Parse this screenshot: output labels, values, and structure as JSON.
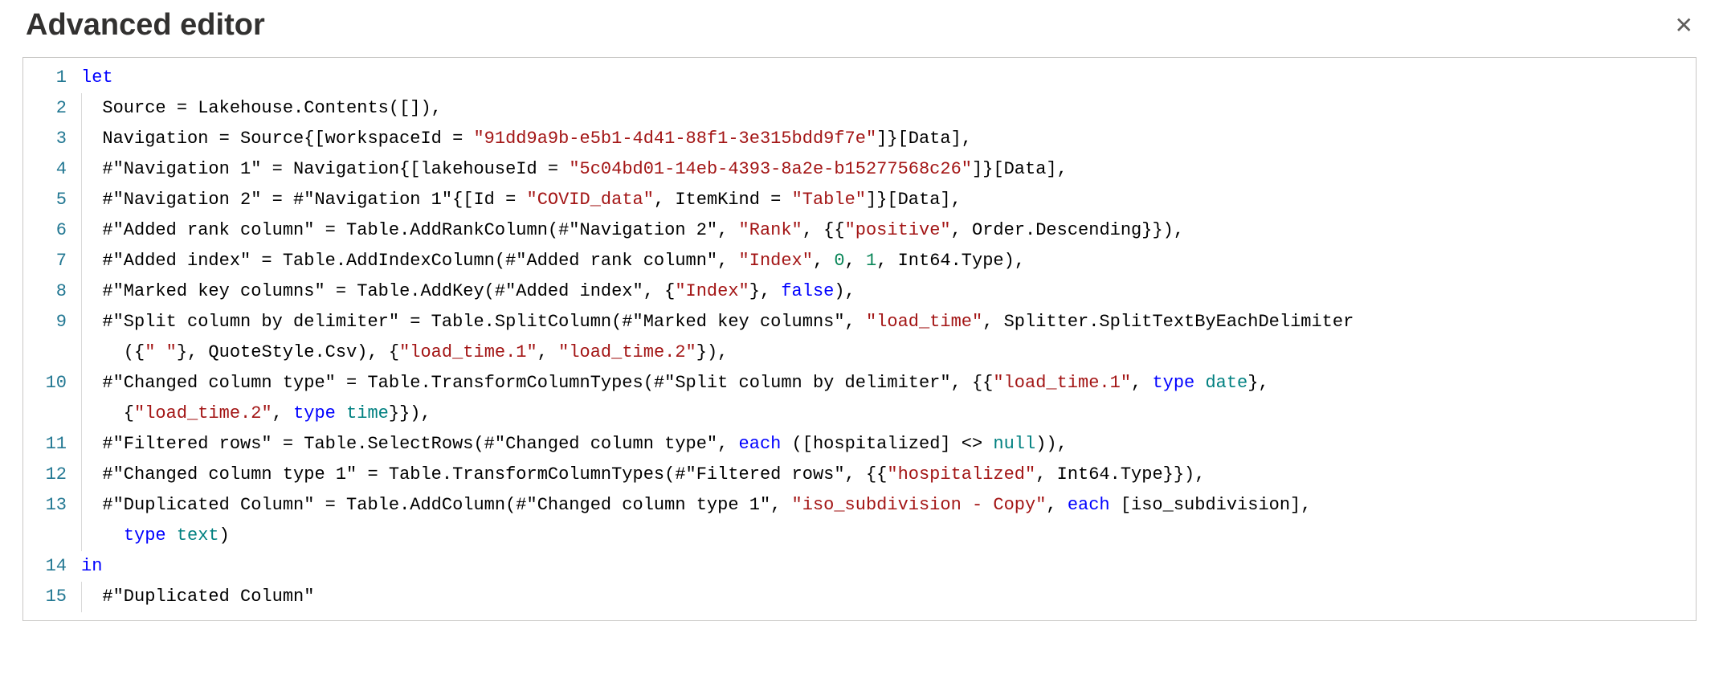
{
  "header": {
    "title": "Advanced editor",
    "close_symbol": "✕"
  },
  "editor": {
    "gutter": [
      "1",
      "2",
      "3",
      "4",
      "5",
      "6",
      "7",
      "8",
      "9",
      "",
      "10",
      "",
      "11",
      "12",
      "13",
      "",
      "14",
      "15"
    ],
    "code": {
      "l1_let": "let",
      "l2_a": "  Source = Lakehouse.Contents([]),",
      "l3_a": "  Navigation = Source{[workspaceId = ",
      "l3_s": "\"91dd9a9b-e5b1-4d41-88f1-3e315bdd9f7e\"",
      "l3_b": "]}[Data],",
      "l4_a": "  #\"Navigation 1\" = Navigation{[lakehouseId = ",
      "l4_s": "\"5c04bd01-14eb-4393-8a2e-b15277568c26\"",
      "l4_b": "]}[Data],",
      "l5_a": "  #\"Navigation 2\" = #\"Navigation 1\"{[Id = ",
      "l5_s1": "\"COVID_data\"",
      "l5_b": ", ItemKind = ",
      "l5_s2": "\"Table\"",
      "l5_c": "]}[Data],",
      "l6_a": "  #\"Added rank column\" = Table.AddRankColumn(#\"Navigation 2\", ",
      "l6_s1": "\"Rank\"",
      "l6_b": ", {{",
      "l6_s2": "\"positive\"",
      "l6_c": ", Order.Descending}}),",
      "l7_a": "  #\"Added index\" = Table.AddIndexColumn(#\"Added rank column\", ",
      "l7_s1": "\"Index\"",
      "l7_b": ", ",
      "l7_n1": "0",
      "l7_c": ", ",
      "l7_n2": "1",
      "l7_d": ", Int64.Type),",
      "l8_a": "  #\"Marked key columns\" = Table.AddKey(#\"Added index\", {",
      "l8_s1": "\"Index\"",
      "l8_b": "}, ",
      "l8_bool": "false",
      "l8_c": "),",
      "l9_a": "  #\"Split column by delimiter\" = Table.SplitColumn(#\"Marked key columns\", ",
      "l9_s1": "\"load_time\"",
      "l9_b": ", Splitter.SplitTextByEachDelimiter",
      "l9w_a": "    ({",
      "l9w_s1": "\" \"",
      "l9w_b": "}, QuoteStyle.Csv), {",
      "l9w_s2": "\"load_time.1\"",
      "l9w_c": ", ",
      "l9w_s3": "\"load_time.2\"",
      "l9w_d": "}),",
      "l10_a": "  #\"Changed column type\" = Table.TransformColumnTypes(#\"Split column by delimiter\", {{",
      "l10_s1": "\"load_time.1\"",
      "l10_b": ", ",
      "l10_kw1": "type",
      "l10_sp": " ",
      "l10_tkw1": "date",
      "l10_c": "}, ",
      "l10w_a": "    {",
      "l10w_s1": "\"load_time.2\"",
      "l10w_b": ", ",
      "l10w_kw1": "type",
      "l10w_sp": " ",
      "l10w_tkw1": "time",
      "l10w_c": "}}),",
      "l11_a": "  #\"Filtered rows\" = Table.SelectRows(#\"Changed column type\", ",
      "l11_kw": "each",
      "l11_b": " ([hospitalized] <> ",
      "l11_null": "null",
      "l11_c": ")),",
      "l12_a": "  #\"Changed column type 1\" = Table.TransformColumnTypes(#\"Filtered rows\", {{",
      "l12_s1": "\"hospitalized\"",
      "l12_b": ", Int64.Type}}),",
      "l13_a": "  #\"Duplicated Column\" = Table.AddColumn(#\"Changed column type 1\", ",
      "l13_s1": "\"iso_subdivision - Copy\"",
      "l13_b": ", ",
      "l13_kw": "each",
      "l13_c": " [iso_subdivision], ",
      "l13w_a": "    ",
      "l13w_kw": "type",
      "l13w_sp": " ",
      "l13w_tkw": "text",
      "l13w_b": ")",
      "l14_in": "in",
      "l15_a": "  #\"Duplicated Column\""
    }
  }
}
